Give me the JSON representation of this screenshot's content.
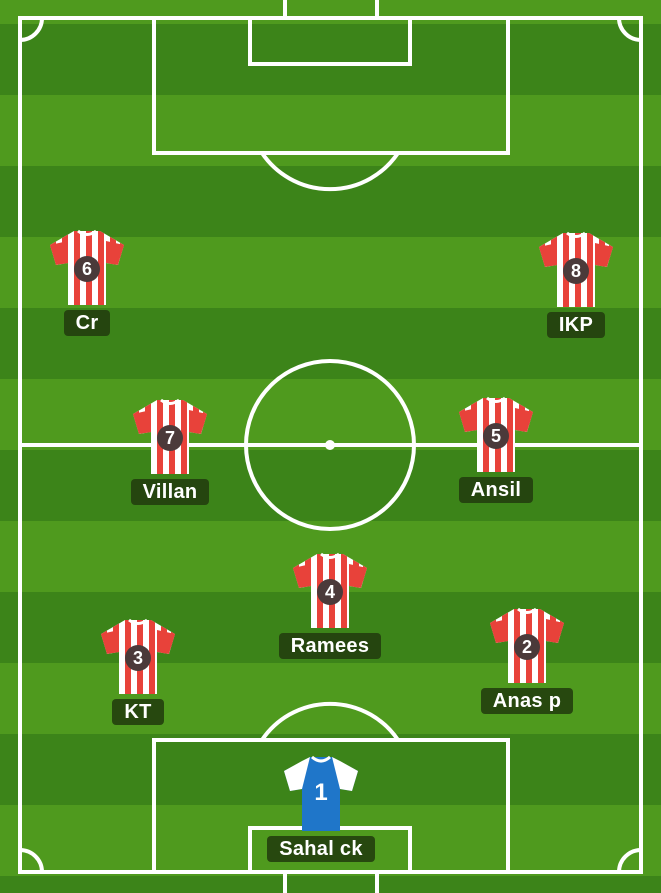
{
  "pitch": {
    "stripe_light": "#4f9a1e",
    "stripe_dark": "#3c8419",
    "line_color": "#ffffff"
  },
  "kit": {
    "outfield": {
      "stripe_a": "#e8423a",
      "stripe_b": "#ffffff",
      "number_bg": "#4b3a3a"
    },
    "goalkeeper": {
      "body": "#1f76c9",
      "sleeves": "#ffffff"
    }
  },
  "players": [
    {
      "number": "6",
      "name": "Cr"
    },
    {
      "number": "8",
      "name": "IKP"
    },
    {
      "number": "7",
      "name": "Villan"
    },
    {
      "number": "5",
      "name": "Ansil"
    },
    {
      "number": "4",
      "name": "Ramees"
    },
    {
      "number": "3",
      "name": "KT"
    },
    {
      "number": "2",
      "name": "Anas p"
    },
    {
      "number": "1",
      "name": "Sahal ck"
    }
  ]
}
